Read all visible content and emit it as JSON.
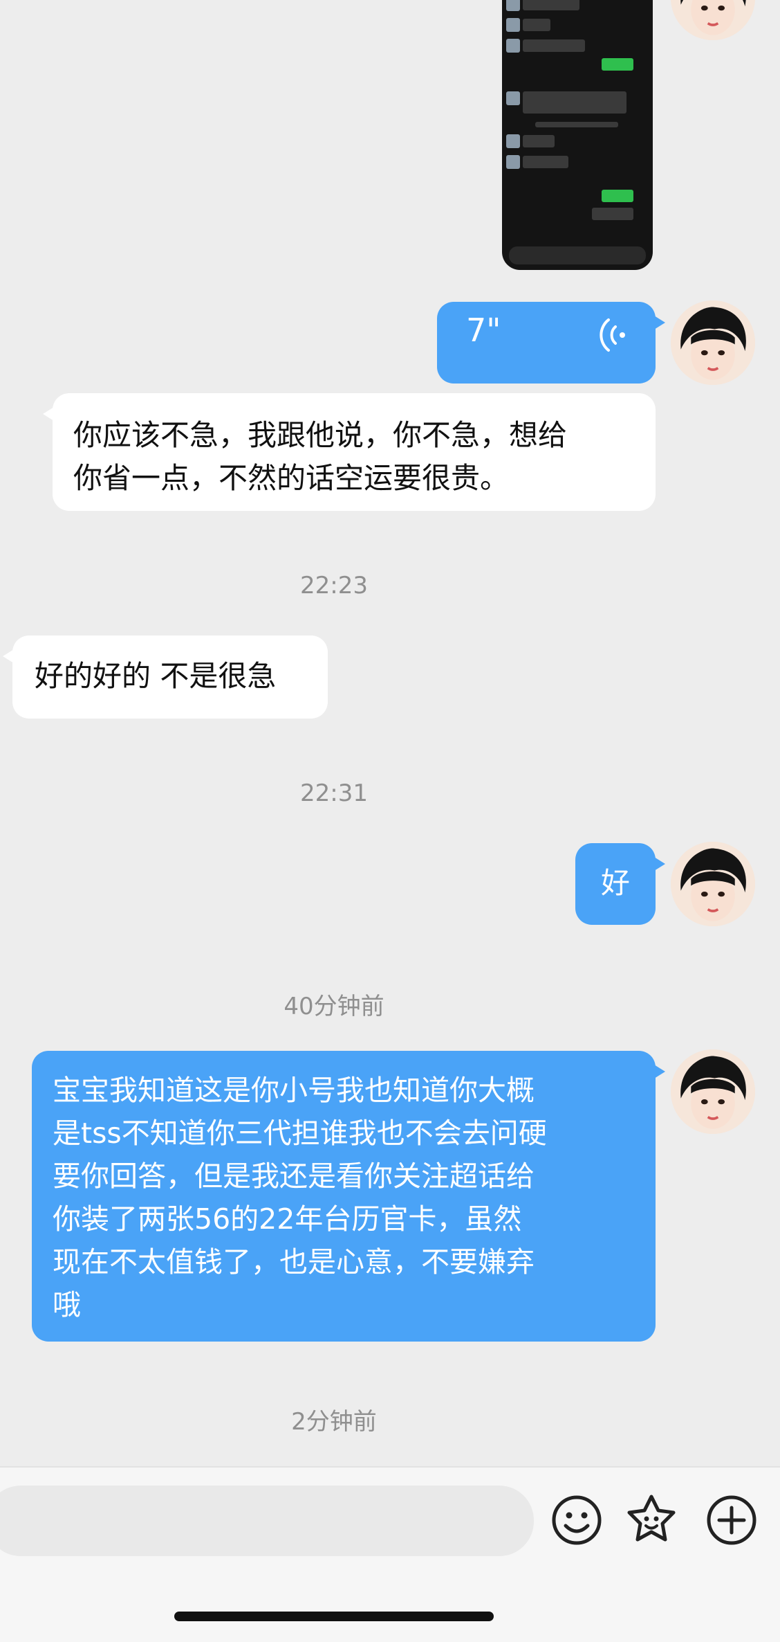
{
  "messages": [
    {
      "id": "m1",
      "side": "mine",
      "kind": "voice",
      "duration": "7\""
    },
    {
      "id": "m2",
      "side": "theirs",
      "kind": "text",
      "lines": [
        "你应该不急，我跟他说，你不急，想给",
        "你省一点，不然的话空运要很贵。"
      ]
    },
    {
      "id": "t1",
      "kind": "timestamp",
      "text": "22:23"
    },
    {
      "id": "m3",
      "side": "theirs",
      "kind": "text",
      "lines": [
        "好的好的 不是很急"
      ]
    },
    {
      "id": "t2",
      "kind": "timestamp",
      "text": "22:31"
    },
    {
      "id": "m4",
      "side": "mine",
      "kind": "text",
      "lines": [
        "好"
      ]
    },
    {
      "id": "t3",
      "kind": "timestamp",
      "text": "40分钟前"
    },
    {
      "id": "m5",
      "side": "mine",
      "kind": "text",
      "lines": [
        "宝宝我知道这是你小号我也知道你大概",
        "是tss不知道你三代担谁我也不会去问硬",
        "要你回答，但是我还是看你关注超话给",
        "你装了两张56的22年台历官卡，虽然",
        "现在不太值钱了，也是心意，不要嫌弃",
        "哦"
      ]
    },
    {
      "id": "t4",
      "kind": "timestamp",
      "text": "2分钟前"
    }
  ],
  "input_bar": {
    "placeholder": "",
    "icons": [
      "emoji-icon",
      "sticker-icon",
      "add-icon"
    ]
  },
  "colors": {
    "background": "#ededed",
    "my_bubble": "#4aa3f7",
    "their_bubble": "#ffffff"
  }
}
